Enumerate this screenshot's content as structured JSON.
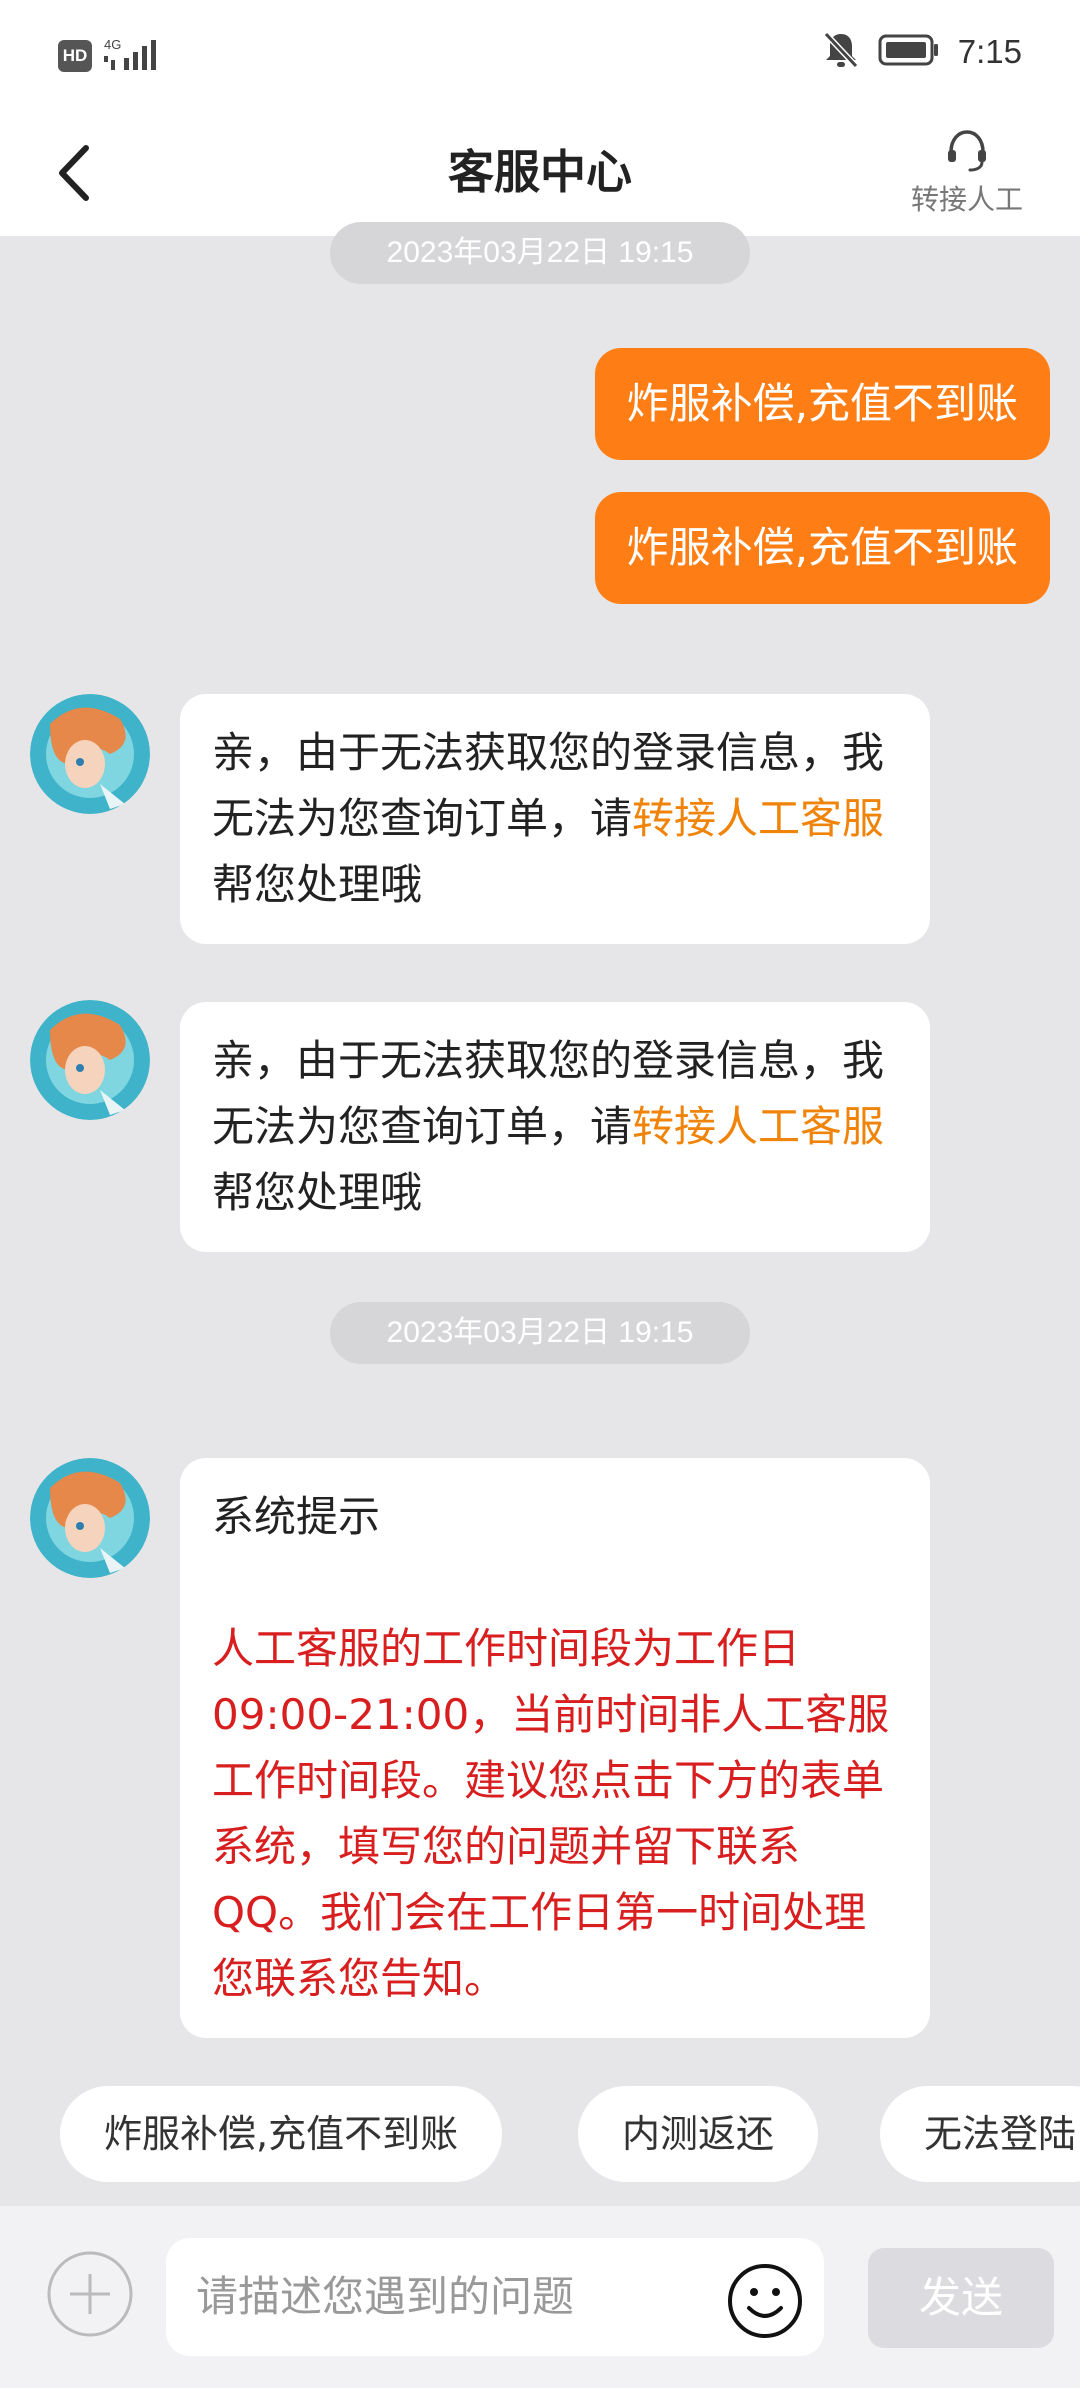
{
  "status_bar": {
    "hd_label": "HD",
    "network_label": "4G",
    "time": "7:15",
    "icons": [
      "signal-icon",
      "mute-bell-icon",
      "battery-icon"
    ]
  },
  "header": {
    "title": "客服中心",
    "transfer_label": "转接人工"
  },
  "chat": {
    "timestamps": [
      "2023年03月22日 19:15",
      "2023年03月22日 19:15"
    ],
    "outgoing": [
      "炸服补偿,充值不到账",
      "炸服补偿,充值不到账"
    ],
    "bot_reply": {
      "before": "亲，由于无法获取您的登录信息，我无法为您查询订单，请",
      "link": "转接人工客服",
      "after": "帮您处理哦"
    },
    "system_notice": {
      "title": "系统提示",
      "body": "人工客服的工作时间段为工作日09:00-21:00，当前时间非人工客服工作时间段。建议您点击下方的表单系统，填写您的问题并留下联系QQ。我们会在工作日第一时间处理您联系您告知。"
    }
  },
  "quick_replies": [
    "炸服补偿,充值不到账",
    "内测返还",
    "无法登陆"
  ],
  "input_bar": {
    "placeholder": "请描述您遇到的问题",
    "send_label": "发送"
  },
  "colors": {
    "accent": "#ff7d15",
    "link": "#f0840a",
    "notice": "#d81e1e",
    "background": "#e6e6e8"
  }
}
